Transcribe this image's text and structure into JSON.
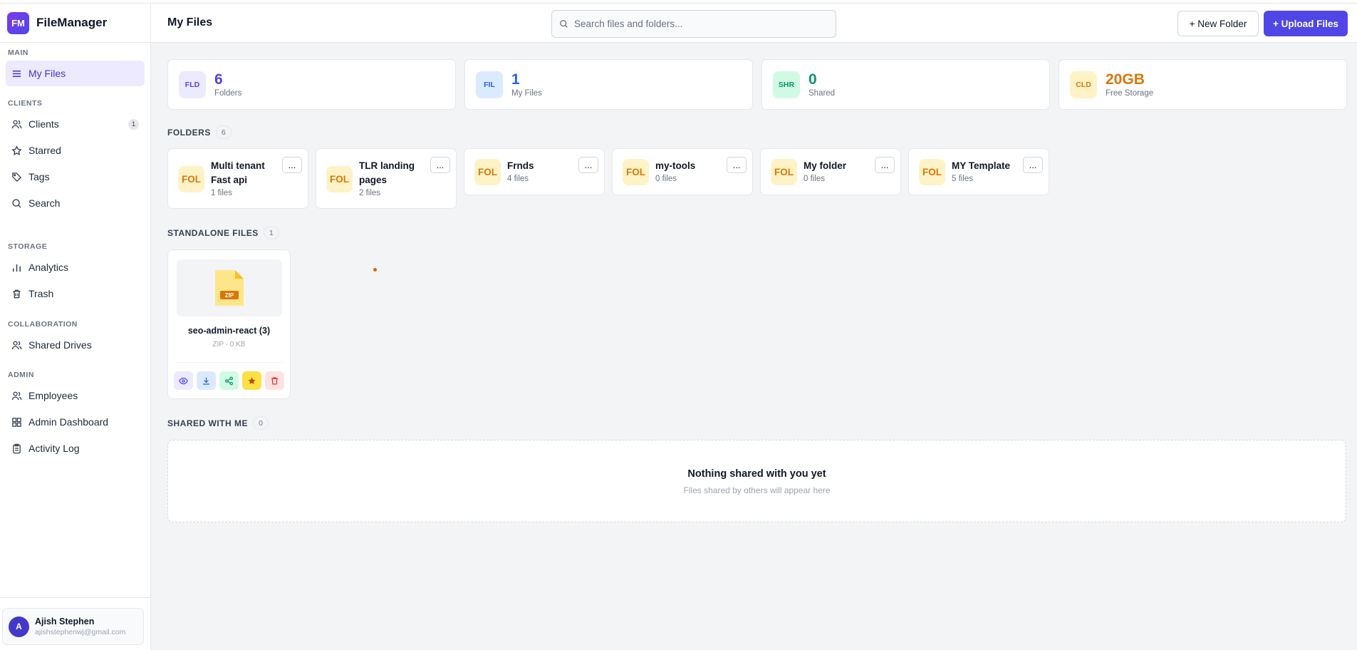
{
  "app": {
    "logo_text": "FM",
    "name": "FileManager"
  },
  "header": {
    "title": "My Files",
    "search_placeholder": "Search files and folders...",
    "new_folder_label": "+ New Folder",
    "upload_label": "+ Upload Files"
  },
  "sidebar": {
    "sections": [
      {
        "label": "MAIN",
        "items": [
          {
            "label": "My Files",
            "icon": "list-icon",
            "active": true
          }
        ]
      },
      {
        "label": "CLIENTS",
        "items": [
          {
            "label": "Clients",
            "icon": "users-icon",
            "badge": "1"
          },
          {
            "label": "Starred",
            "icon": "star-icon"
          },
          {
            "label": "Tags",
            "icon": "tag-icon"
          },
          {
            "label": "Search",
            "icon": "search-icon"
          }
        ]
      },
      {
        "label": "STORAGE",
        "items": [
          {
            "label": "Analytics",
            "icon": "bar-chart-icon"
          },
          {
            "label": "Trash",
            "icon": "trash-icon"
          }
        ]
      },
      {
        "label": "COLLABORATION",
        "items": [
          {
            "label": "Shared Drives",
            "icon": "users-icon"
          }
        ]
      },
      {
        "label": "ADMIN",
        "items": [
          {
            "label": "Employees",
            "icon": "users-icon"
          },
          {
            "label": "Admin Dashboard",
            "icon": "grid-icon"
          },
          {
            "label": "Activity Log",
            "icon": "clipboard-icon"
          }
        ]
      }
    ],
    "user": {
      "initial": "A",
      "name": "Ajish Stephen",
      "email": "ajishstephenwj@gmail.com"
    }
  },
  "stats": [
    {
      "icon_text": "FLD",
      "value": "6",
      "label": "Folders",
      "color": "#4f46e5",
      "bg": "#ede9fe"
    },
    {
      "icon_text": "FIL",
      "value": "1",
      "label": "My Files",
      "color": "#2563eb",
      "bg": "#dbeafe"
    },
    {
      "icon_text": "SHR",
      "value": "0",
      "label": "Shared",
      "color": "#059669",
      "bg": "#d1fae5"
    },
    {
      "icon_text": "CLD",
      "value": "20GB",
      "label": "Free Storage",
      "color": "#d97706",
      "bg": "#fef3c7"
    }
  ],
  "folders_section": {
    "title": "FOLDERS",
    "count": "6"
  },
  "folders": [
    {
      "icon_text": "FOL",
      "name": "Multi tenant Fast api",
      "count": "1 files"
    },
    {
      "icon_text": "FOL",
      "name": "TLR landing pages",
      "count": "2 files"
    },
    {
      "icon_text": "FOL",
      "name": "Frnds",
      "count": "4 files"
    },
    {
      "icon_text": "FOL",
      "name": "my-tools",
      "count": "0 files"
    },
    {
      "icon_text": "FOL",
      "name": "My folder",
      "count": "0 files"
    },
    {
      "icon_text": "FOL",
      "name": "MY Template",
      "count": "5 files"
    }
  ],
  "more_label": "...",
  "standalone_section": {
    "title": "STANDALONE FILES",
    "count": "1"
  },
  "files": [
    {
      "name": "seo-admin-react (3)",
      "meta": "ZIP · 0 KB",
      "badge": "ZIP"
    }
  ],
  "shared_section": {
    "title": "SHARED WITH ME",
    "count": "0",
    "empty_title": "Nothing shared with you yet",
    "empty_subtitle": "Files shared by others will appear here"
  }
}
